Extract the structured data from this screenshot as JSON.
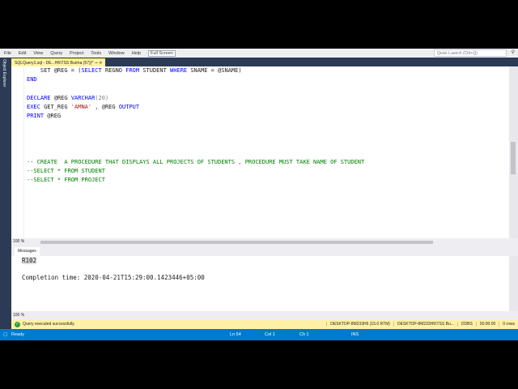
{
  "menu": [
    "File",
    "Edit",
    "View",
    "Query",
    "Project",
    "Tools",
    "Window",
    "Help"
  ],
  "full_screen": "Full Screen",
  "quick_launch": "Quick Launch (Ctrl+Q)",
  "object_explorer": "Object Explorer",
  "doc_tab": "SQLQuery1.sql - DE...H6\\TSS Burma (57))*",
  "code": {
    "l1a": "    SET @REG = (",
    "l1b": "SELECT",
    " l1c": "",
    "l1d": " REGNO ",
    "l1e": "FROM",
    "l1f": " STUDENT ",
    "l1g": "WHERE",
    "l1h": " SNAME = @SNAME)",
    "l2": "END",
    "l3a": "DECLARE",
    "l3b": " @REG ",
    "l3c": "VARCHAR",
    "l3d": "(20)",
    "l4a": "EXEC",
    "l4b": " GET_REG ",
    "l4c": "'AMNA'",
    "l4d": " , @REG ",
    "l4e": "OUTPUT",
    "l5a": "PRINT",
    "l5b": " @REG",
    "l6": "-- CREATE  A PROCEDURE THAT DISPLAYS ALL PROJECTS OF STUDENTS , PROCEDURE MUST TAKE NAME OF STUDENT",
    "l7": "--SELECT * FROM STUDENT",
    "l8": "--SELECT * FROM PROJECT"
  },
  "zoom": "100 %",
  "messages_tab": "Messages",
  "result_value": "R102",
  "completion": "Completion time: 2020-04-21T15:29:00.1423446+05:00",
  "query_status": "Query executed successfully.",
  "server": "DESKTOP-8M233H6 (15.0 RTM)",
  "user": "DESKTOP-8M233H6\\TSS Bu...",
  "db": "DDBS",
  "time": "00:00:00",
  "rows": "0 rows",
  "status": {
    "ready": "Ready",
    "ln": "Ln 54",
    "col": "Col 1",
    "ch": "Ch 1",
    "ins": "INS"
  }
}
